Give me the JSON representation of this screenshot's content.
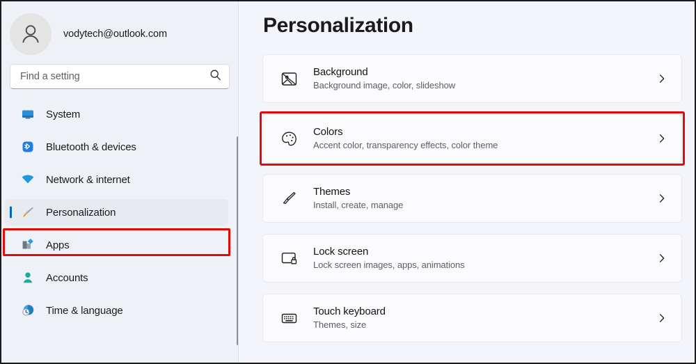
{
  "colors": {
    "sidebar_bg": "#eef2f6",
    "main_bg": "#f3f5fb",
    "card_bg": "#fbfbfd",
    "accent": "#0067c0",
    "highlight_red": "#e00b0b",
    "text_primary": "#1b1b1b",
    "text_secondary": "#5b6067"
  },
  "sidebar": {
    "account": {
      "email": "vodytech@outlook.com",
      "avatar_icon": "person-avatar-icon"
    },
    "search": {
      "placeholder": "Find a setting",
      "value": "",
      "icon": "search-icon"
    },
    "items": [
      {
        "label": "System",
        "icon": "monitor-icon",
        "selected": false
      },
      {
        "label": "Bluetooth & devices",
        "icon": "bluetooth-icon",
        "selected": false
      },
      {
        "label": "Network & internet",
        "icon": "wifi-icon",
        "selected": false
      },
      {
        "label": "Personalization",
        "icon": "paintbrush-icon",
        "selected": true
      },
      {
        "label": "Apps",
        "icon": "apps-icon",
        "selected": false
      },
      {
        "label": "Accounts",
        "icon": "person-icon",
        "selected": false
      },
      {
        "label": "Time & language",
        "icon": "clock-globe-icon",
        "selected": false
      }
    ]
  },
  "main": {
    "title": "Personalization",
    "cards": [
      {
        "title": "Background",
        "subtitle": "Background image, color, slideshow",
        "icon": "picture-icon",
        "chevron": "chevron-right-icon",
        "highlighted": false
      },
      {
        "title": "Colors",
        "subtitle": "Accent color, transparency effects, color theme",
        "icon": "palette-icon",
        "chevron": "chevron-right-icon",
        "highlighted": true
      },
      {
        "title": "Themes",
        "subtitle": "Install, create, manage",
        "icon": "paintbrush-outline-icon",
        "chevron": "chevron-right-icon",
        "highlighted": false
      },
      {
        "title": "Lock screen",
        "subtitle": "Lock screen images, apps, animations",
        "icon": "lock-screen-icon",
        "chevron": "chevron-right-icon",
        "highlighted": false
      },
      {
        "title": "Touch keyboard",
        "subtitle": "Themes, size",
        "icon": "keyboard-icon",
        "chevron": "chevron-right-icon",
        "highlighted": false
      }
    ]
  }
}
